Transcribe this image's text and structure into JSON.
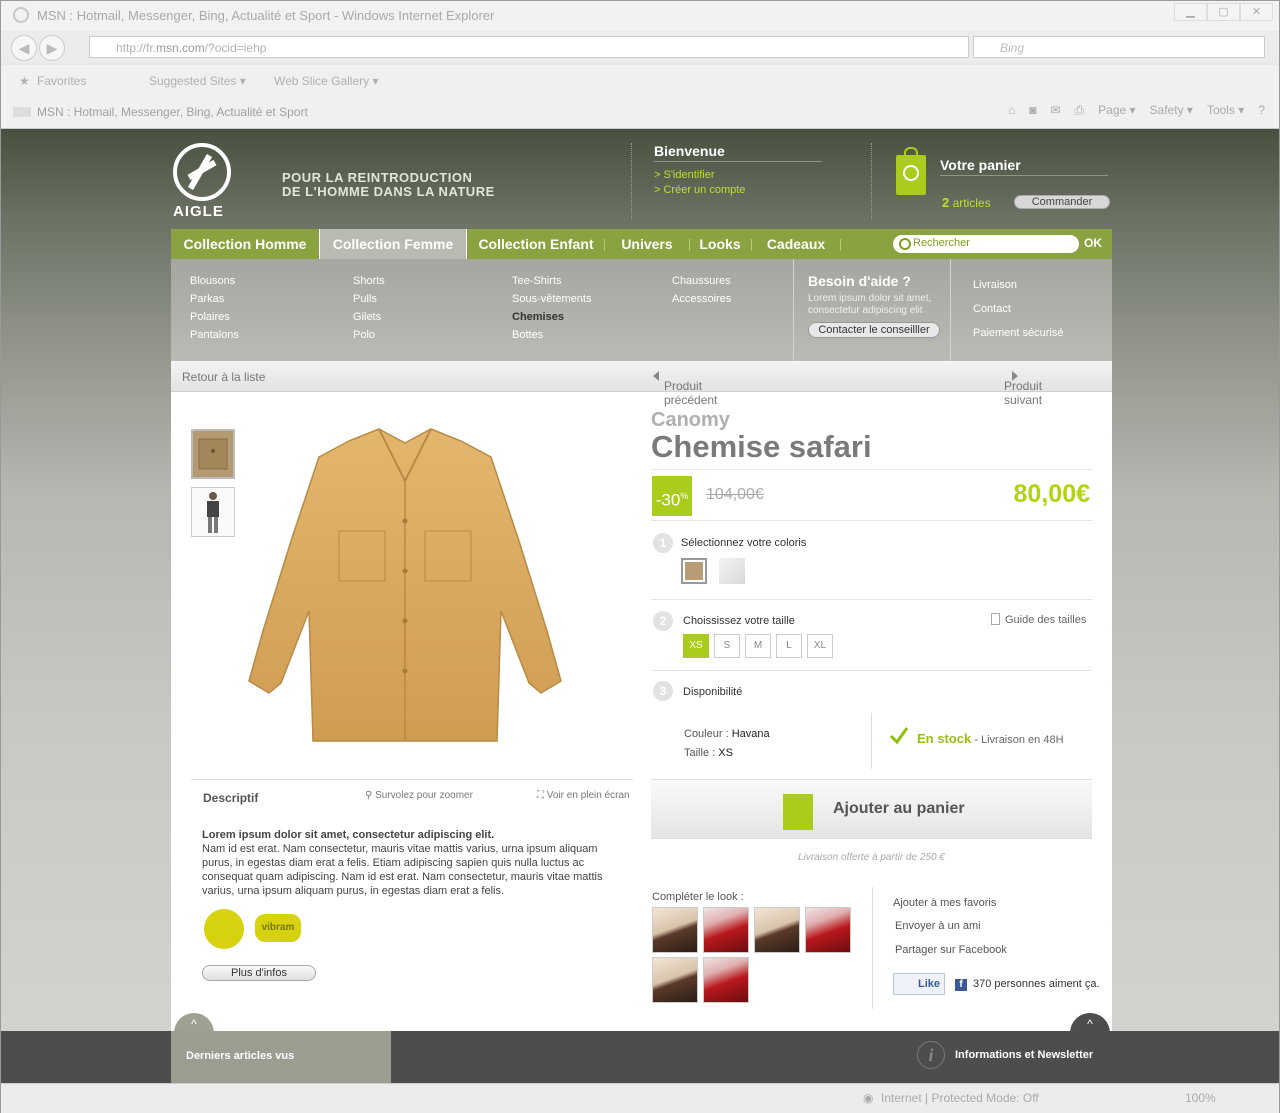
{
  "browser": {
    "title": "MSN : Hotmail, Messenger, Bing, Actualité et Sport - Windows Internet Explorer",
    "window_controls": [
      "▁",
      "▢",
      "✕"
    ],
    "url_prefix": "http://fr.",
    "url_domain": "msn.com",
    "url_suffix": "/?ocid=iehp",
    "search_placeholder": "Bing",
    "favorites": "Favorites",
    "suggested_sites": "Suggested Sites ▾",
    "web_slice": "Web Slice Gallery ▾",
    "tab_title": "MSN : Hotmail, Messenger, Bing, Actualité et Sport",
    "tools": [
      "Page ▾",
      "Safety ▾",
      "Tools ▾"
    ],
    "status": "Internet | Protected Mode: Off",
    "zoom": "100%"
  },
  "header": {
    "logo_text": "AIGLE",
    "tagline_1": "POUR LA REINTRODUCTION",
    "tagline_2": "DE L'HOMME DANS LA NATURE",
    "welcome_title": "Bienvenue",
    "login_link": "> S'identifier",
    "create_link": "> Créer un compte",
    "cart_title": "Votre panier",
    "cart_count": "2",
    "cart_articles": " articles",
    "order_button": "Commander"
  },
  "nav": {
    "items": [
      "Collection Homme",
      "Collection Femme",
      "Collection Enfant",
      "Univers",
      "Looks",
      "Cadeaux"
    ],
    "active_index": 1,
    "search_placeholder": "Rechercher",
    "ok": "OK"
  },
  "dropdown": {
    "col1": [
      "Blousons",
      "Parkas",
      "Polaires",
      "Pantalons"
    ],
    "col2": [
      "Shorts",
      "Pulls",
      "Gilets",
      "Polo"
    ],
    "col3": [
      "Tee-Shirts",
      "Sous-vêtements",
      "Chemises",
      "Bottes"
    ],
    "col4": [
      "Chaussures",
      "Accessoires"
    ],
    "help_title": "Besoin d'aide ?",
    "help_text": "Lorem ipsum dolor sit amet, consectetur adipiscing elit",
    "help_button": "Contacter le conseilller",
    "right": [
      "Livraison",
      "Contact",
      "Paiement sécurisé"
    ]
  },
  "breadcrumb": {
    "back": "Retour à la liste",
    "prev": "Produit précédent",
    "next": "Produit suivant"
  },
  "product": {
    "brand": "Canomy",
    "name": "Chemise safari",
    "discount": "-30",
    "discount_sup": "%",
    "old_price": "104,00€",
    "price": "80,00€",
    "step1": "Sélectionnez votre coloris",
    "step2": "Choississez votre taille",
    "size_guide": "Guide des tailles",
    "sizes": [
      "XS",
      "S",
      "M",
      "L",
      "XL"
    ],
    "selected_size": "XS",
    "step3": "Disponibilité",
    "color_label": "Couleur : ",
    "color_value": "Havana",
    "size_label": "Taille : ",
    "size_value": "XS",
    "stock": "En stock",
    "delivery": " - Livraison en 48H",
    "add_to_cart": "Ajouter au panier",
    "free_shipping": "Livraison offerte à partir de 250 €",
    "complete_look": "Compléter  le look :",
    "actions": [
      "Ajouter à mes favoris",
      "Envoyer à un ami",
      "Partager sur Facebook"
    ],
    "like": "Like",
    "fb_count": "370 personnes aiment ça.",
    "step_numbers": [
      "1",
      "2",
      "3"
    ]
  },
  "description": {
    "tab": "Descriptif",
    "zoom": "Survolez pour zoomer",
    "fullscreen": "Voir en plein écran",
    "lead": "Lorem ipsum dolor sit amet, consectetur adipiscing elit.",
    "body": "Nam id est erat. Nam consectetur, mauris vitae mattis varius, urna ipsum aliquam purus, in egestas diam erat a felis. Etiam adipiscing sapien quis nulla luctus ac consequat quam adipiscing. Nam id est erat. Nam consectetur, mauris vitae mattis varius, urna ipsum aliquam purus, in egestas diam erat a felis.",
    "badge2": "vibram",
    "more_button": "Plus d'infos"
  },
  "footer": {
    "recent": "Derniers articles vus",
    "info": "Informations et Newsletter",
    "info_icon": "i"
  },
  "colors": {
    "accent_green": "#a9cc1d",
    "nav_green": "#8aa240",
    "price_green": "#b3d20f"
  }
}
